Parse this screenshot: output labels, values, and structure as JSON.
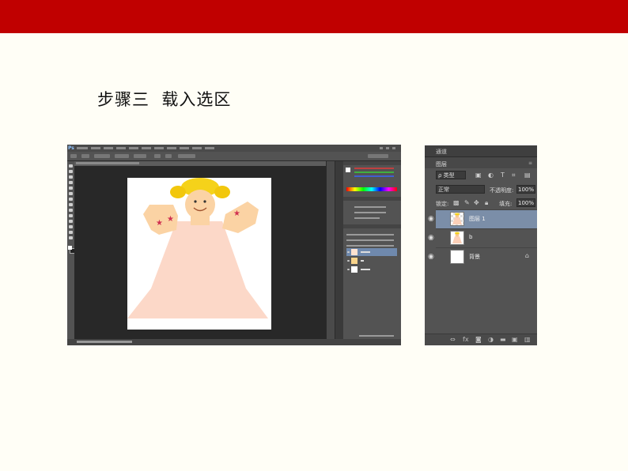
{
  "slide": {
    "heading": "步骤三  载入选区",
    "colors": {
      "top_bar": "#c00000",
      "background": "#fffef6"
    }
  },
  "photoshop": {
    "app_icon": "photoshop-logo",
    "canvas_subject": "cartoon girl in pink dress",
    "layers": [
      {
        "name": "图层 1",
        "selected": true
      },
      {
        "name": "b",
        "selected": false
      },
      {
        "name": "背景",
        "selected": false
      }
    ]
  },
  "layers_panel": {
    "channels_tab": "通道",
    "layers_tab": "图层",
    "kind_filter": "ρ 类型",
    "blend_mode": "正常",
    "opacity_label": "不透明度:",
    "opacity_value": "100%",
    "lock_label": "锁定:",
    "fill_label": "填充:",
    "fill_value": "100%",
    "layers": [
      {
        "name": "图层 1",
        "selected": true
      },
      {
        "name": "b",
        "selected": false
      },
      {
        "name": "背景",
        "selected": false,
        "locked": true
      }
    ],
    "bottom_icons": [
      "link-icon",
      "fx-icon",
      "mask-icon",
      "adjustment-icon",
      "folder-icon",
      "new-layer-icon",
      "trash-icon"
    ]
  }
}
